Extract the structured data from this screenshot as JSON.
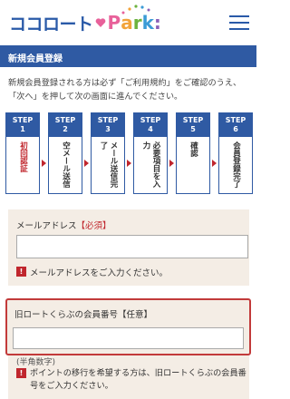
{
  "header": {
    "logo_jp": "ココロート",
    "logo_park_letters": [
      "P",
      "a",
      "r",
      "k",
      ":"
    ],
    "logo_park_colors": [
      "#e8619a",
      "#f2a33a",
      "#6db33f",
      "#3b9bd6",
      "#8a5fb8"
    ],
    "heart_color": "#e8619a",
    "brand_color": "#2a5aa8",
    "menu_icon": "hamburger-icon"
  },
  "page": {
    "title": "新規会員登録",
    "intro": "新規会員登録される方は必ず「ご利用規約」をご確認のうえ、「次へ」を押して次の画面に進んでください。"
  },
  "steps": [
    {
      "step": "STEP",
      "num": "1",
      "label": "初回認証",
      "active": true
    },
    {
      "step": "STEP",
      "num": "2",
      "label": "空メール送信",
      "active": false
    },
    {
      "step": "STEP",
      "num": "3",
      "label": "メール送信完了",
      "active": false
    },
    {
      "step": "STEP",
      "num": "4",
      "label": "必要項目を入力",
      "active": false
    },
    {
      "step": "STEP",
      "num": "5",
      "label": "確認",
      "active": false
    },
    {
      "step": "STEP",
      "num": "6",
      "label": "会員登録完了",
      "active": false
    }
  ],
  "form": {
    "email": {
      "label": "メールアドレス",
      "required": "【必須】",
      "value": "",
      "error": "メールアドレスをご入力ください。"
    },
    "member_no": {
      "label": "旧ロートくらぶの会員番号【任意】",
      "value": "",
      "note": "(半角数字)",
      "error": "ポイントの移行を希望する方は、旧ロートくらぶの会員番号をご入力ください。"
    },
    "error_icon_text": "!"
  },
  "colors": {
    "accent": "#2f5aa3",
    "error": "#c0262d",
    "field_bg": "#f4ede5",
    "focus_border": "#c23a3a"
  }
}
